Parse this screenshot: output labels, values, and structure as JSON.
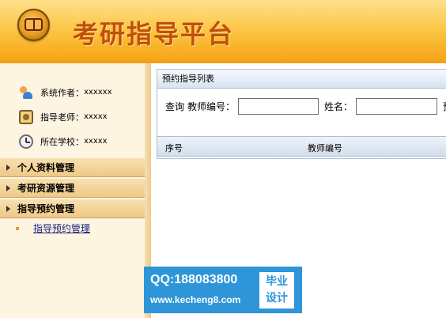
{
  "header": {
    "title": "考研指导平台"
  },
  "sidebar": {
    "info": [
      {
        "label": "系统作者：",
        "value": "xxxxxx",
        "icon": "users-icon"
      },
      {
        "label": "指导老师：",
        "value": "xxxxx",
        "icon": "teacher-icon"
      },
      {
        "label": "所在学校：",
        "value": "xxxxx",
        "icon": "clock-icon"
      }
    ],
    "menu": [
      {
        "label": "个人资料管理"
      },
      {
        "label": "考研资源管理"
      },
      {
        "label": "指导预约管理"
      }
    ],
    "submenu": [
      {
        "label": "指导预约管理"
      }
    ]
  },
  "panel": {
    "title": "预约指导列表",
    "search": {
      "query_label": "查询",
      "teacher_label": "教师编号：",
      "teacher_value": "",
      "name_label": "姓名：",
      "name_value": "",
      "trailing": "预"
    },
    "table": {
      "columns": [
        "序号",
        "教师编号"
      ]
    }
  },
  "watermark": {
    "qq": "QQ:188083800",
    "url": "www.kecheng8.com",
    "badge_line1": "毕业",
    "badge_line2": "设计"
  }
}
